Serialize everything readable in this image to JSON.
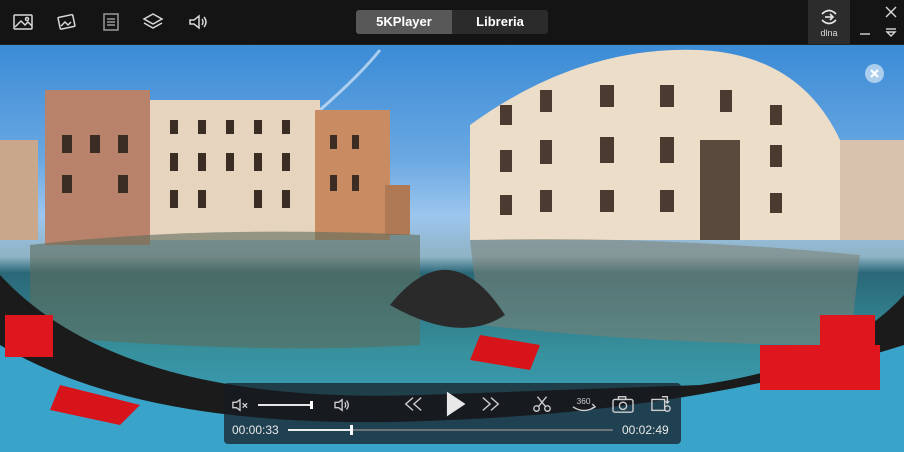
{
  "app": {
    "name": "5KPlayer"
  },
  "toolbar": {
    "icons": [
      "photo-icon",
      "photo-edit-icon",
      "playlist-icon",
      "layers-icon",
      "audio-icon"
    ]
  },
  "tabs": [
    {
      "label": "5KPlayer",
      "active": true
    },
    {
      "label": "Libreria",
      "active": false
    }
  ],
  "dlna": {
    "label": "dlna"
  },
  "window_controls": [
    "close-icon",
    "minimize-icon",
    "dropdown-icon"
  ],
  "player": {
    "current_time": "00:00:33",
    "total_time": "00:02:49",
    "progress": 0.195,
    "volume": 1.0,
    "muted": false,
    "buttons": [
      "mute-icon",
      "volume-icon",
      "rewind-icon",
      "play-icon",
      "fast-forward-icon",
      "scissors-icon",
      "360-icon",
      "camera-icon",
      "rotate-icon"
    ],
    "label_360": "360"
  },
  "colors": {
    "topbar_bg": "#141414",
    "tab_active": "#585858",
    "tab_inactive": "#2b2b2b",
    "dlna_bg": "#2c2c2c",
    "controls_bg": "rgba(22,28,34,0.72)"
  }
}
